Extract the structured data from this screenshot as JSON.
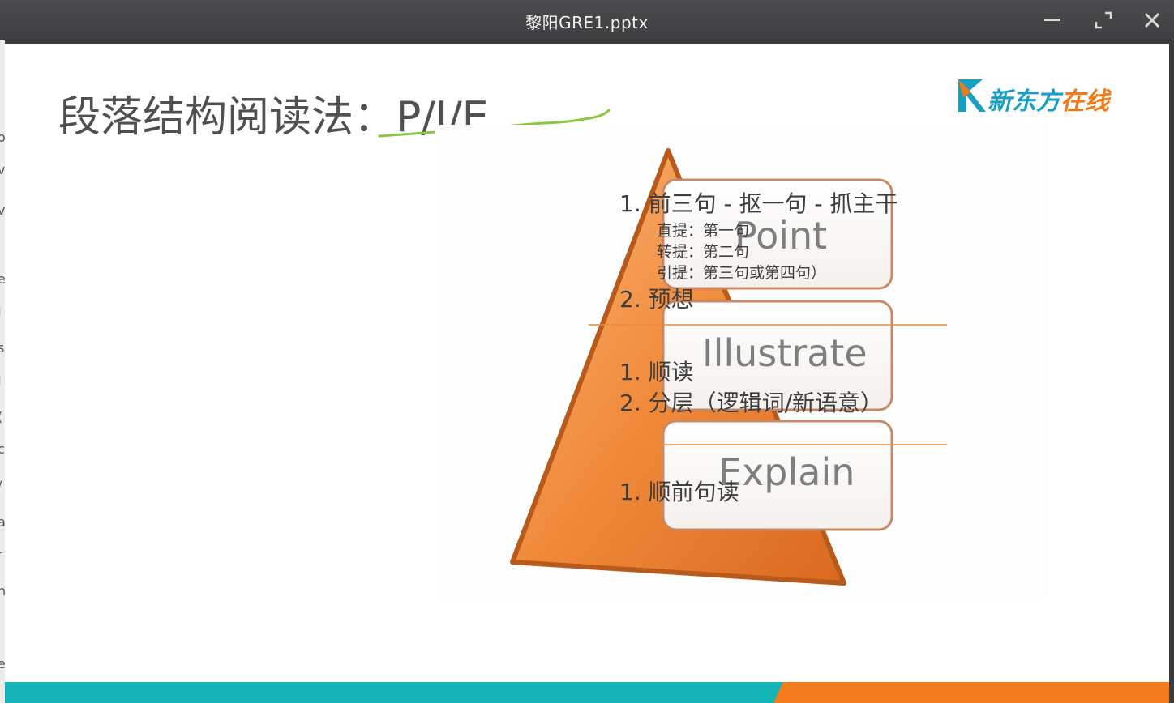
{
  "window": {
    "title": "黎阳GRE1.pptx",
    "controls": {
      "minimize_icon": "minimize-icon",
      "maximize_icon": "maximize-icon",
      "close_icon": "close-icon"
    }
  },
  "left_strip": {
    "chars": [
      "o",
      "v",
      "v",
      "e",
      "I",
      "s",
      "I",
      "(",
      "c",
      "/",
      "a",
      "r",
      "h",
      "i",
      "e"
    ]
  },
  "slide": {
    "title": "段落结构阅读法：P/I/E",
    "logo": {
      "part1": "新东方",
      "part2": "在线",
      "icon": "new-oriental-logo-icon"
    },
    "cards": {
      "point": "Point",
      "illustrate": "Illustrate",
      "explain": "Explain"
    },
    "point_section": {
      "item1": "1.  前三句 - 抠一句 - 抓主干",
      "sub1": "直提：第一句",
      "sub2": "转提：第二句",
      "sub3": "引提：第三句或第四句）",
      "item2": "2.   预想"
    },
    "illustrate_section": {
      "item1": "1. 顺读",
      "item2": "2. 分层（逻辑词/新语意）"
    },
    "explain_section": {
      "item1": "1. 顺前句读"
    },
    "colors": {
      "accent_teal": "#14b4b6",
      "accent_orange": "#f57c1c",
      "triangle": "#f08a3a",
      "underline_green": "#8cc63f"
    }
  }
}
